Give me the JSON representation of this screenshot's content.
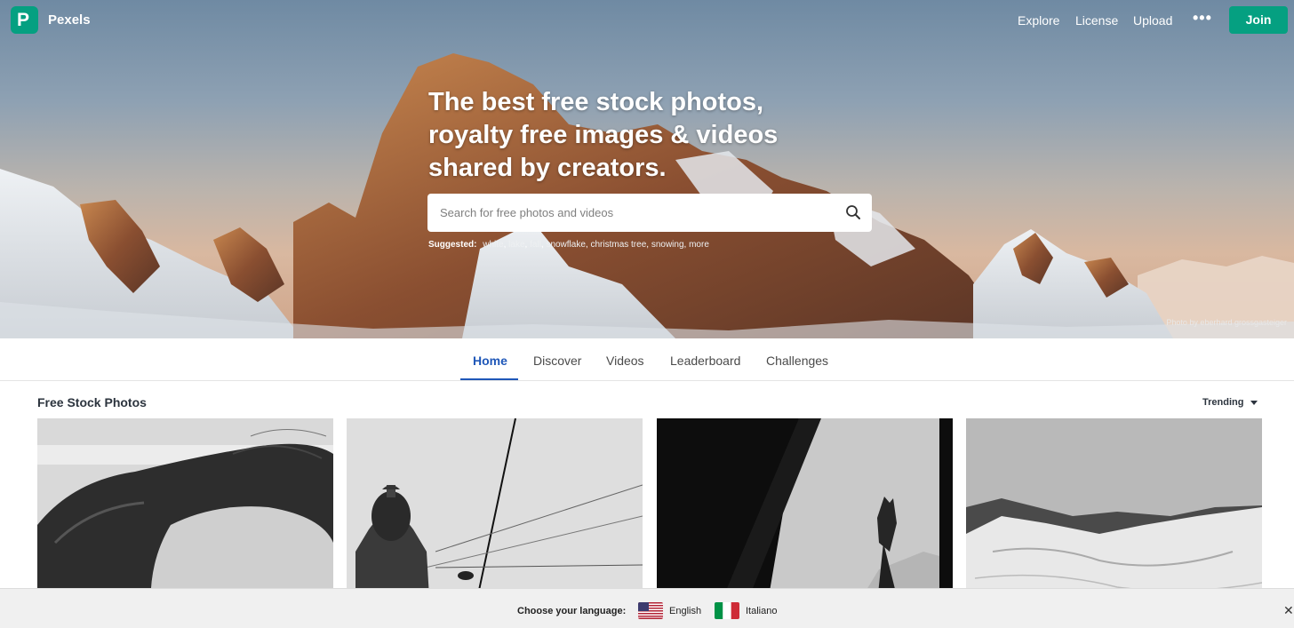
{
  "header": {
    "brand": "Pexels",
    "logo_letter": "P",
    "nav": [
      "Explore",
      "License",
      "Upload"
    ],
    "more": "•••",
    "join": "Join"
  },
  "hero": {
    "headline": "The best free stock photos, royalty free images & videos shared by creators.",
    "search_placeholder": "Search for free photos and videos",
    "suggested_label": "Suggested:",
    "suggested": [
      "white",
      "lake",
      "fall",
      "snowflake",
      "christmas tree",
      "snowing",
      "more"
    ],
    "credit": "Photo by eberhard grossgasteiger"
  },
  "tabs": [
    {
      "label": "Home",
      "active": true
    },
    {
      "label": "Discover"
    },
    {
      "label": "Videos"
    },
    {
      "label": "Leaderboard"
    },
    {
      "label": "Challenges"
    }
  ],
  "content": {
    "title": "Free Stock Photos",
    "sort": "Trending"
  },
  "language_bar": {
    "label": "Choose your language:",
    "options": [
      "English",
      "Italiano"
    ]
  },
  "colors": {
    "accent": "#05a081",
    "active_tab": "#1f57b8"
  }
}
